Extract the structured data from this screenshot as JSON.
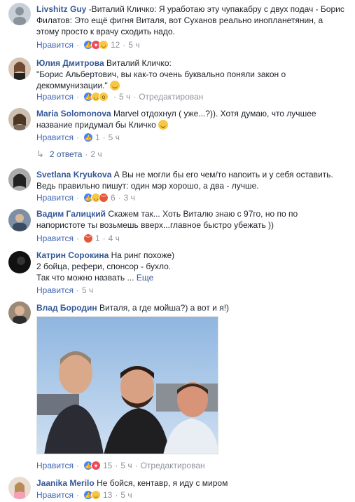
{
  "comments": [
    {
      "name": "Livshitz Guy",
      "text": "-Виталий Кличко: Я уработаю эту чупакабру с двух подач - Борис Филатов: Это ещё фигня Виталя, вот Суханов реально инопланетянин, а этому просто к врачу сходить надо.",
      "like_label": "Нравится",
      "reactions": [
        "like",
        "love",
        "haha"
      ],
      "count": "12",
      "time": "5 ч"
    },
    {
      "name": "Юлия Дмитрова",
      "text": "Виталий Кличко:",
      "text2": "\"Борис Альбертович, вы как-то очень буквально поняли закон о декоммунизации.\"",
      "like_label": "Нравится",
      "reactions": [
        "like",
        "haha",
        "wow"
      ],
      "count": "",
      "time": "5 ч",
      "edited": "Отредактирован"
    },
    {
      "name": "Maria Solomonova",
      "text": "Marvel отдохнул ( уже...?)). Хотя думаю, что лучшее название придумал бы Кличко",
      "like_label": "Нравится",
      "reactions": [
        "like"
      ],
      "count": "1",
      "time": "5 ч",
      "replies_label": "2 ответа",
      "replies_time": "2 ч"
    },
    {
      "name": "Svetlana Kryukova",
      "text": "А Вы не могли бы его чем/то напоить и у себя оставить. Ведь правильно пишут: один мэр хорошо, а два - лучше.",
      "like_label": "Нравится",
      "reactions": [
        "like",
        "haha",
        "angry"
      ],
      "count": "6",
      "time": "3 ч"
    },
    {
      "name": "Вадим Галицкий",
      "text": "Скажем так... Хоть Виталю знаю с 97го, но по по напористоте ты возьмешь вверх...главное быстро убежать ))",
      "like_label": "Нравится",
      "reactions": [
        "angry"
      ],
      "count": "1",
      "time": "4 ч"
    },
    {
      "name": "Катрин Сорокина",
      "text": "На ринг похоже)",
      "text2": "2 бойца, рефери, спонсор - бухло.",
      "text3": "Так что можно назвать ...",
      "more": "Еще",
      "like_label": "Нравится",
      "time": "5 ч"
    },
    {
      "name": "Влад Бородин",
      "text": "Виталя, а где мойша?) а вот и я!)",
      "like_label": "Нравится",
      "reactions": [
        "like",
        "love"
      ],
      "count": "15",
      "time": "5 ч",
      "edited": "Отредактирован"
    },
    {
      "name": "Jaanika Merilo",
      "text": "Не бойся, кентавр, я иду с миром",
      "like_label": "Нравится",
      "reactions": [
        "like",
        "haha"
      ],
      "count": "13",
      "time": "5 ч"
    }
  ],
  "colors": {
    "name": "#365899",
    "text": "#1d2129",
    "meta": "#90949c",
    "like_action": "#4267b2"
  },
  "icons": [
    "reply-arrow-icon",
    "smile-emoji-icon",
    "like-reaction-icon",
    "love-reaction-icon",
    "haha-reaction-icon",
    "wow-reaction-icon",
    "angry-reaction-icon"
  ]
}
